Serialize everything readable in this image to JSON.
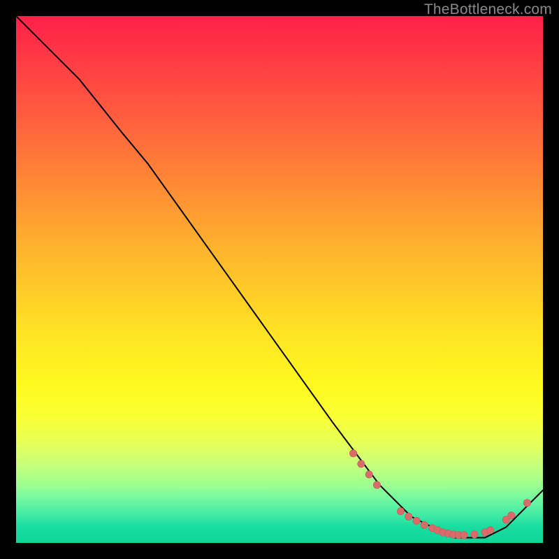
{
  "watermark": "TheBottleneck.com",
  "colors": {
    "curve_stroke": "#000000",
    "dot_fill": "#d96b6b",
    "dot_stroke": "#c65a5a"
  },
  "chart_data": {
    "type": "line",
    "title": "",
    "xlabel": "",
    "ylabel": "",
    "xlim": [
      0,
      100
    ],
    "ylim": [
      0,
      100
    ],
    "grid": false,
    "legend": false,
    "series": [
      {
        "name": "bottleneck-curve",
        "x": [
          0,
          4,
          8,
          12,
          16,
          20,
          25,
          30,
          35,
          40,
          45,
          50,
          55,
          60,
          63,
          66,
          69,
          71,
          73,
          75,
          77,
          79,
          81,
          83,
          85,
          87,
          89,
          91,
          93,
          95,
          97,
          99,
          100
        ],
        "y": [
          100,
          96,
          92,
          88,
          83,
          78,
          72,
          65,
          58,
          51,
          44,
          37,
          30,
          23,
          19,
          15,
          11,
          9,
          7,
          5,
          4,
          3,
          2,
          1,
          1,
          1,
          1,
          2,
          3,
          5,
          7,
          9,
          10
        ]
      }
    ],
    "points": [
      {
        "x": 64,
        "y": 17
      },
      {
        "x": 65.5,
        "y": 15
      },
      {
        "x": 67,
        "y": 13
      },
      {
        "x": 68.5,
        "y": 11
      },
      {
        "x": 73,
        "y": 6
      },
      {
        "x": 74.5,
        "y": 5
      },
      {
        "x": 76,
        "y": 4.2
      },
      {
        "x": 77.5,
        "y": 3.4
      },
      {
        "x": 79,
        "y": 2.8
      },
      {
        "x": 80,
        "y": 2.4
      },
      {
        "x": 81,
        "y": 2.0
      },
      {
        "x": 82,
        "y": 1.8
      },
      {
        "x": 83,
        "y": 1.6
      },
      {
        "x": 84,
        "y": 1.5
      },
      {
        "x": 85,
        "y": 1.5
      },
      {
        "x": 87,
        "y": 1.6
      },
      {
        "x": 89,
        "y": 2.0
      },
      {
        "x": 90,
        "y": 2.4
      },
      {
        "x": 93,
        "y": 4.4
      },
      {
        "x": 94,
        "y": 5.2
      },
      {
        "x": 97,
        "y": 7.6
      }
    ],
    "dot_radius": 5.2
  }
}
